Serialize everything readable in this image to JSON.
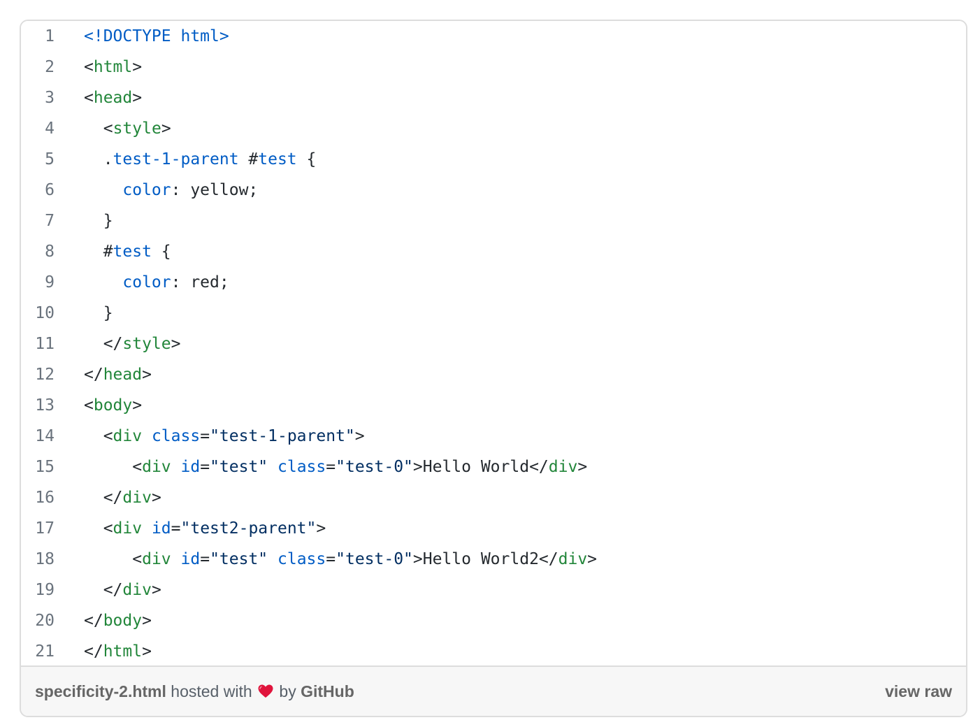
{
  "gist": {
    "filename": "specificity-2.html",
    "hosted_with_text": "hosted with",
    "by_text": "by",
    "host_name": "GitHub",
    "view_raw_label": "view raw",
    "heart_icon": "heart-icon",
    "heart_color": "#e0143c"
  },
  "code": {
    "colors": {
      "tag": "#22863a",
      "attribute": "#005cc5",
      "string": "#032f62",
      "text": "#24292e",
      "line_number": "#6a737d"
    },
    "lines": [
      {
        "num": "1",
        "tokens": [
          [
            "doctype",
            "<!DOCTYPE html>"
          ]
        ]
      },
      {
        "num": "2",
        "tokens": [
          [
            "punct",
            "<"
          ],
          [
            "tag",
            "html"
          ],
          [
            "punct",
            ">"
          ]
        ]
      },
      {
        "num": "3",
        "tokens": [
          [
            "punct",
            "<"
          ],
          [
            "tag",
            "head"
          ],
          [
            "punct",
            ">"
          ]
        ]
      },
      {
        "num": "4",
        "tokens": [
          [
            "text",
            "  "
          ],
          [
            "punct",
            "<"
          ],
          [
            "tag",
            "style"
          ],
          [
            "punct",
            ">"
          ]
        ]
      },
      {
        "num": "5",
        "tokens": [
          [
            "text",
            "  ."
          ],
          [
            "sel",
            "test-1-parent"
          ],
          [
            "text",
            " #"
          ],
          [
            "sel",
            "test"
          ],
          [
            "text",
            " {"
          ]
        ]
      },
      {
        "num": "6",
        "tokens": [
          [
            "text",
            "    "
          ],
          [
            "prop",
            "color"
          ],
          [
            "text",
            ": yellow;"
          ]
        ]
      },
      {
        "num": "7",
        "tokens": [
          [
            "text",
            "  }"
          ]
        ]
      },
      {
        "num": "8",
        "tokens": [
          [
            "text",
            "  #"
          ],
          [
            "sel",
            "test"
          ],
          [
            "text",
            " {"
          ]
        ]
      },
      {
        "num": "9",
        "tokens": [
          [
            "text",
            "    "
          ],
          [
            "prop",
            "color"
          ],
          [
            "text",
            ": red;"
          ]
        ]
      },
      {
        "num": "10",
        "tokens": [
          [
            "text",
            "  }"
          ]
        ]
      },
      {
        "num": "11",
        "tokens": [
          [
            "text",
            "  </"
          ],
          [
            "tag",
            "style"
          ],
          [
            "punct",
            ">"
          ]
        ]
      },
      {
        "num": "12",
        "tokens": [
          [
            "punct",
            "</"
          ],
          [
            "tag",
            "head"
          ],
          [
            "punct",
            ">"
          ]
        ]
      },
      {
        "num": "13",
        "tokens": [
          [
            "punct",
            "<"
          ],
          [
            "tag",
            "body"
          ],
          [
            "punct",
            ">"
          ]
        ]
      },
      {
        "num": "14",
        "tokens": [
          [
            "text",
            "  <"
          ],
          [
            "tag",
            "div"
          ],
          [
            "text",
            " "
          ],
          [
            "attr",
            "class"
          ],
          [
            "text",
            "="
          ],
          [
            "str",
            "\"test-1-parent\""
          ],
          [
            "punct",
            ">"
          ]
        ]
      },
      {
        "num": "15",
        "tokens": [
          [
            "text",
            "     <"
          ],
          [
            "tag",
            "div"
          ],
          [
            "text",
            " "
          ],
          [
            "attr",
            "id"
          ],
          [
            "text",
            "="
          ],
          [
            "str",
            "\"test\""
          ],
          [
            "text",
            " "
          ],
          [
            "attr",
            "class"
          ],
          [
            "text",
            "="
          ],
          [
            "str",
            "\"test-0\""
          ],
          [
            "text",
            ">Hello World</"
          ],
          [
            "tag",
            "div"
          ],
          [
            "punct",
            ">"
          ]
        ]
      },
      {
        "num": "16",
        "tokens": [
          [
            "text",
            "  </"
          ],
          [
            "tag",
            "div"
          ],
          [
            "punct",
            ">"
          ]
        ]
      },
      {
        "num": "17",
        "tokens": [
          [
            "text",
            "  <"
          ],
          [
            "tag",
            "div"
          ],
          [
            "text",
            " "
          ],
          [
            "attr",
            "id"
          ],
          [
            "text",
            "="
          ],
          [
            "str",
            "\"test2-parent\""
          ],
          [
            "punct",
            ">"
          ]
        ]
      },
      {
        "num": "18",
        "tokens": [
          [
            "text",
            "     <"
          ],
          [
            "tag",
            "div"
          ],
          [
            "text",
            " "
          ],
          [
            "attr",
            "id"
          ],
          [
            "text",
            "="
          ],
          [
            "str",
            "\"test\""
          ],
          [
            "text",
            " "
          ],
          [
            "attr",
            "class"
          ],
          [
            "text",
            "="
          ],
          [
            "str",
            "\"test-0\""
          ],
          [
            "text",
            ">Hello World2</"
          ],
          [
            "tag",
            "div"
          ],
          [
            "punct",
            ">"
          ]
        ]
      },
      {
        "num": "19",
        "tokens": [
          [
            "text",
            "  </"
          ],
          [
            "tag",
            "div"
          ],
          [
            "punct",
            ">"
          ]
        ]
      },
      {
        "num": "20",
        "tokens": [
          [
            "punct",
            "</"
          ],
          [
            "tag",
            "body"
          ],
          [
            "punct",
            ">"
          ]
        ]
      },
      {
        "num": "21",
        "tokens": [
          [
            "punct",
            "</"
          ],
          [
            "tag",
            "html"
          ],
          [
            "punct",
            ">"
          ]
        ]
      }
    ]
  }
}
